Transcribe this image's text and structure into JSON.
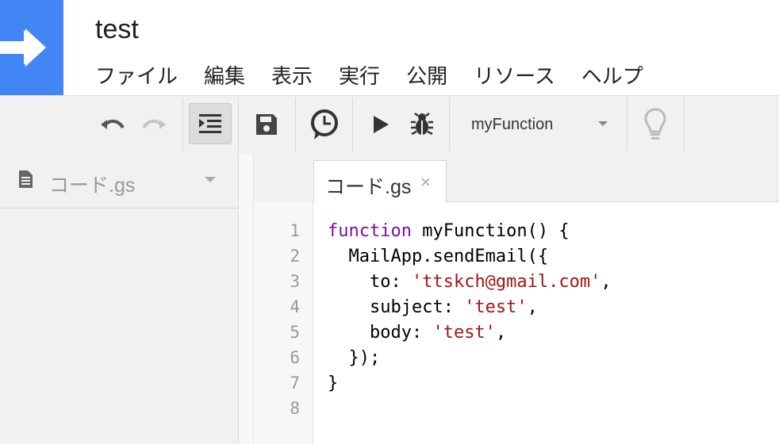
{
  "app": {
    "title": "test"
  },
  "menu": [
    "ファイル",
    "編集",
    "表示",
    "実行",
    "公開",
    "リソース",
    "ヘルプ"
  ],
  "toolbar": {
    "function_select": "myFunction"
  },
  "sidebar": {
    "file_name": "コード.gs"
  },
  "editor": {
    "tab_label": "コード.gs",
    "tab_close": "×",
    "line_numbers": [
      "1",
      "2",
      "3",
      "4",
      "5",
      "6",
      "7",
      "8"
    ],
    "code": {
      "l1_kw": "function",
      "l1_rest": " myFunction() {",
      "l2": "  MailApp.sendEmail({",
      "l3_pre": "    to: ",
      "l3_str": "'ttskch@gmail.com'",
      "l3_post": ",",
      "l4_pre": "    subject: ",
      "l4_str": "'test'",
      "l4_post": ",",
      "l5_pre": "    body: ",
      "l5_str": "'test'",
      "l5_post": ",",
      "l6": "  });",
      "l7": "}",
      "l8": ""
    }
  },
  "colors": {
    "brand": "#4285f4",
    "keyword": "#7a0fa0",
    "string": "#a31515"
  },
  "icons": [
    "arrow-logo-icon",
    "undo-icon",
    "redo-icon",
    "indent-icon",
    "save-icon",
    "clock-trigger-icon",
    "run-icon",
    "debug-bug-icon",
    "lightbulb-icon",
    "document-icon"
  ]
}
